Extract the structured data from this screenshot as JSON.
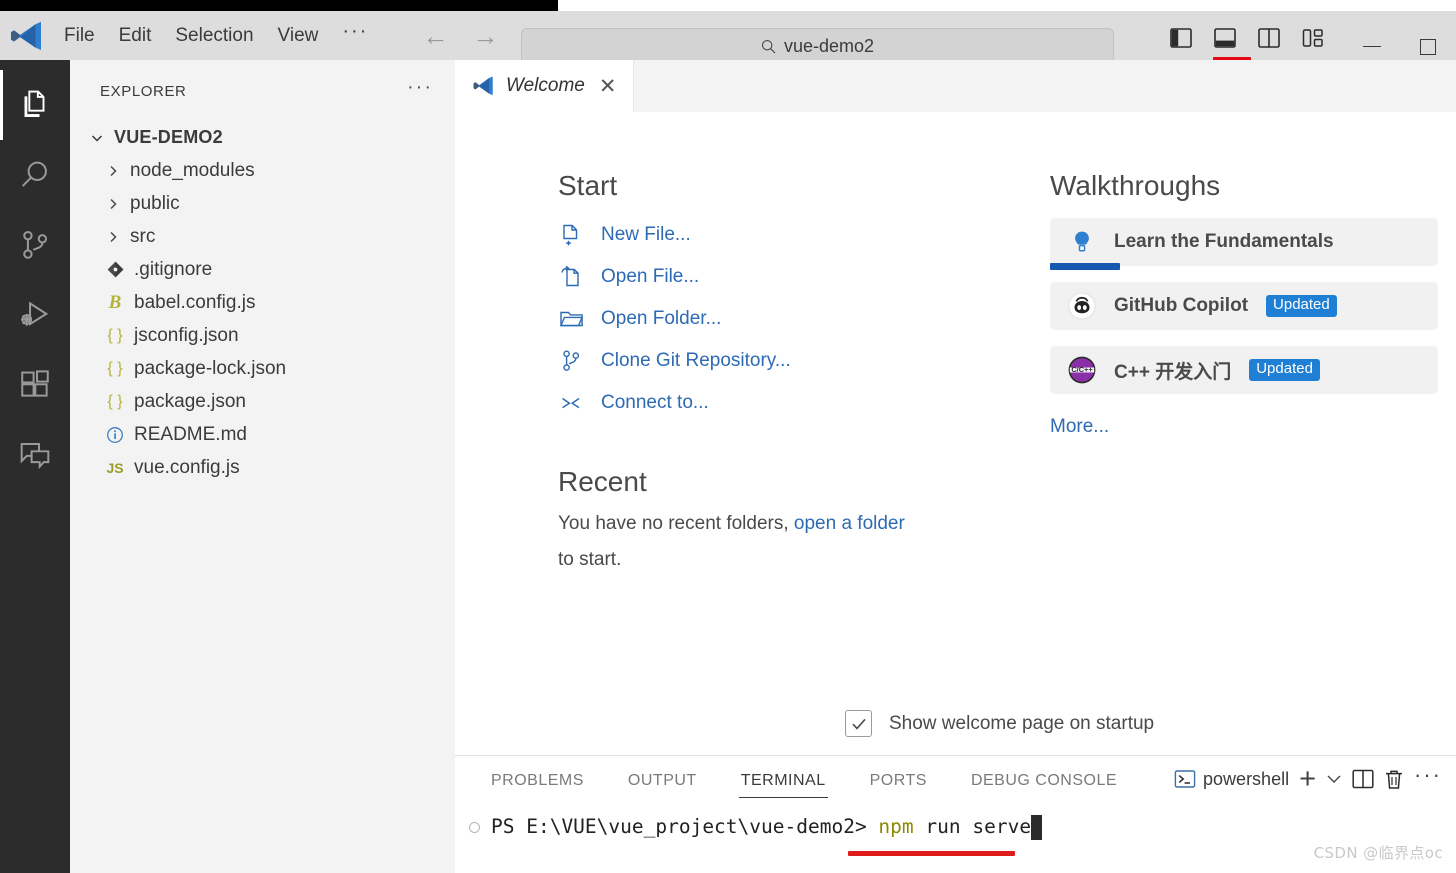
{
  "titlebar": {
    "menu": [
      "File",
      "Edit",
      "Selection",
      "View"
    ],
    "overflow_label": "···",
    "back_glyph": "←",
    "forward_glyph": "→",
    "search_value": "vue-demo2",
    "search_placeholder": "Search"
  },
  "activitybar": {
    "items": [
      {
        "name": "explorer",
        "active": true
      },
      {
        "name": "search",
        "active": false
      },
      {
        "name": "source-control",
        "active": false
      },
      {
        "name": "run-and-debug",
        "active": false
      },
      {
        "name": "extensions",
        "active": false
      },
      {
        "name": "chat",
        "active": false
      }
    ]
  },
  "sidebar": {
    "title": "EXPLORER",
    "more_actions": "···",
    "root": {
      "label": "VUE-DEMO2",
      "expanded": true
    },
    "items": [
      {
        "label": "node_modules",
        "type": "folder",
        "icon": "chevron-right-icon"
      },
      {
        "label": "public",
        "type": "folder",
        "icon": "chevron-right-icon"
      },
      {
        "label": "src",
        "type": "folder",
        "icon": "chevron-right-icon"
      },
      {
        "label": ".gitignore",
        "type": "file",
        "icon": "git-icon",
        "icon_text": "",
        "color": "#4a4a4a"
      },
      {
        "label": "babel.config.js",
        "type": "file",
        "icon": "babel-icon",
        "icon_text": "B",
        "color": "#b3b33a"
      },
      {
        "label": "jsconfig.json",
        "type": "file",
        "icon": "json-icon",
        "icon_text": "{ }",
        "color": "#b3b33a"
      },
      {
        "label": "package-lock.json",
        "type": "file",
        "icon": "json-icon",
        "icon_text": "{ }",
        "color": "#b3b33a"
      },
      {
        "label": "package.json",
        "type": "file",
        "icon": "json-icon",
        "icon_text": "{ }",
        "color": "#b3b33a"
      },
      {
        "label": "README.md",
        "type": "file",
        "icon": "info-icon",
        "icon_text": "",
        "color": "#3f7fc1"
      },
      {
        "label": "vue.config.js",
        "type": "file",
        "icon": "js-icon",
        "icon_text": "JS",
        "color": "#b3b33a"
      }
    ]
  },
  "editor": {
    "tab": {
      "label": "Welcome",
      "close_glyph": "✕",
      "icon": "vscode-logo-icon"
    }
  },
  "welcome": {
    "start": {
      "heading": "Start",
      "items": [
        {
          "label": "New File...",
          "icon": "new-file-icon"
        },
        {
          "label": "Open File...",
          "icon": "open-file-icon"
        },
        {
          "label": "Open Folder...",
          "icon": "open-folder-icon"
        },
        {
          "label": "Clone Git Repository...",
          "icon": "git-branch-icon"
        },
        {
          "label": "Connect to...",
          "icon": "remote-connect-icon"
        }
      ]
    },
    "recent": {
      "heading": "Recent",
      "text_before": "You have no recent folders, ",
      "link": "open a folder",
      "text_after": " to start."
    },
    "walkthroughs": {
      "heading": "Walkthroughs",
      "items": [
        {
          "label": "Learn the Fundamentals",
          "icon": "lightbulb-icon",
          "badge": "",
          "progress": true
        },
        {
          "label": "GitHub Copilot",
          "icon": "copilot-icon",
          "badge": "Updated",
          "progress": false
        },
        {
          "label": "C++ 开发入门",
          "icon": "cpp-icon",
          "badge": "Updated",
          "progress": false
        }
      ],
      "more": "More..."
    },
    "startup_checkbox": {
      "label": "Show welcome page on startup",
      "checked": true
    }
  },
  "panel": {
    "tabs": [
      {
        "label": "PROBLEMS",
        "active": false
      },
      {
        "label": "OUTPUT",
        "active": false
      },
      {
        "label": "TERMINAL",
        "active": true
      },
      {
        "label": "PORTS",
        "active": false
      },
      {
        "label": "DEBUG CONSOLE",
        "active": false
      }
    ],
    "shell": "powershell",
    "new_terminal_glyph": "+",
    "dropdown_glyph": "⌄",
    "more_actions": "···",
    "terminal": {
      "prompt": "PS E:\\VUE\\vue_project\\vue-demo2> ",
      "command_head": "npm",
      "command_tail": " run serve"
    }
  },
  "watermark": "CSDN @临界点oc",
  "colors": {
    "accent_blue": "#2d6ab4",
    "badge_blue": "#1f7fd4",
    "annotation_red": "#e01b1b",
    "activitybar_bg": "#2c2c2c",
    "sidebar_bg": "#f3f3f3",
    "titlebar_bg": "#dddddd"
  }
}
